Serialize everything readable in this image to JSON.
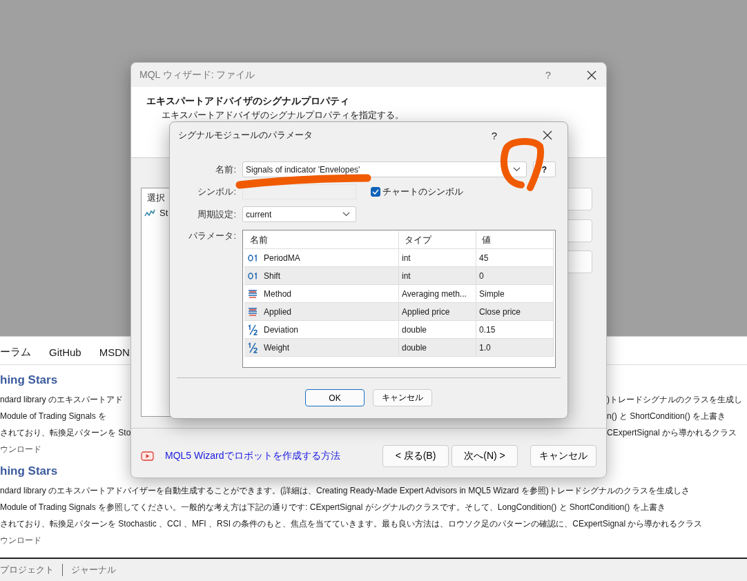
{
  "background_app": {
    "tabs": [
      "ーラム",
      "GitHub",
      "MSDN"
    ],
    "articles": [
      {
        "title": "hing Stars",
        "lines": [
          {
            "left": "ndard library のエキスパートアド",
            "right": ")トレードシグナルのクラスを生成し"
          },
          {
            "left": "Module of Trading Signals を",
            "right": "n() と ShortCondition() を上書き"
          },
          {
            "left": "されており、転換足パターンを Sto",
            "right": "CExpertSignal から導かれるクラス"
          }
        ],
        "download": "ウンロード"
      },
      {
        "title": "hing Stars",
        "lines": [
          {
            "left": "ndard library のエキスパートアドバイザーを自動生成することができます。(詳細は、Creating Ready-Made Expert Advisors in MQL5 Wizard を参照)トレードシグナルのクラスを生成しさ"
          },
          {
            "left": "Module of Trading Signals を参照してください。一般的な考え方は下記の通りです: CExpertSignal がシグナルのクラスです。そして、LongCondition() と ShortCondition() を上書き"
          },
          {
            "left": "されており、転換足パターンを Stochastic 、CCI 、MFI 、RSI の条件のもと、焦点を当てていきます。最も良い方法は、ロウソク足のパターンの確認に、CExpertSignal から導かれるクラス"
          }
        ],
        "download": "ウンロード"
      }
    ],
    "bottom_tabs": [
      "プロジェクト",
      "ジャーナル"
    ]
  },
  "wizard": {
    "title": "MQL ウィザード: ファイル",
    "help": "?",
    "header_title": "エキスパートアドバイザのシグナルプロパティ",
    "header_subtitle": "エキスパートアドバイザのシグナルプロパティを指定する。",
    "list": {
      "header": "選択",
      "items": [
        "St"
      ]
    },
    "video_link": "MQL5 Wizardでロボットを作成する方法",
    "buttons": [
      "< 戻る(B)",
      "次へ(N) >",
      "キャンセル"
    ]
  },
  "dialog": {
    "title": "シグナルモジュールのパラメータ",
    "help": "?",
    "name_label": "名前:",
    "name_value": "Signals of indicator 'Envelopes'",
    "name_help": "?",
    "symbol_label": "シンボル:",
    "chart_symbol": {
      "label": "チャートのシンボル",
      "checked": true
    },
    "period_label": "周期設定:",
    "period_value": "current",
    "params_label": "パラメータ:",
    "table": {
      "columns": [
        "名前",
        "タイプ",
        "値"
      ],
      "rows": [
        {
          "kind": "integer",
          "name": "PeriodMA",
          "type": "int",
          "value": "45"
        },
        {
          "kind": "integer",
          "name": "Shift",
          "type": "int",
          "value": "0"
        },
        {
          "kind": "enum",
          "name": "Method",
          "type": "Averaging meth...",
          "value": "Simple"
        },
        {
          "kind": "enum",
          "name": "Applied",
          "type": "Applied price",
          "value": "Close price"
        },
        {
          "kind": "real",
          "name": "Deviation",
          "type": "double",
          "value": "0.15"
        },
        {
          "kind": "real",
          "name": "Weight",
          "type": "double",
          "value": "1.0"
        }
      ]
    },
    "buttons": [
      {
        "label": "OK",
        "default": true
      },
      {
        "label": "キャンセル",
        "default": false
      }
    ]
  }
}
